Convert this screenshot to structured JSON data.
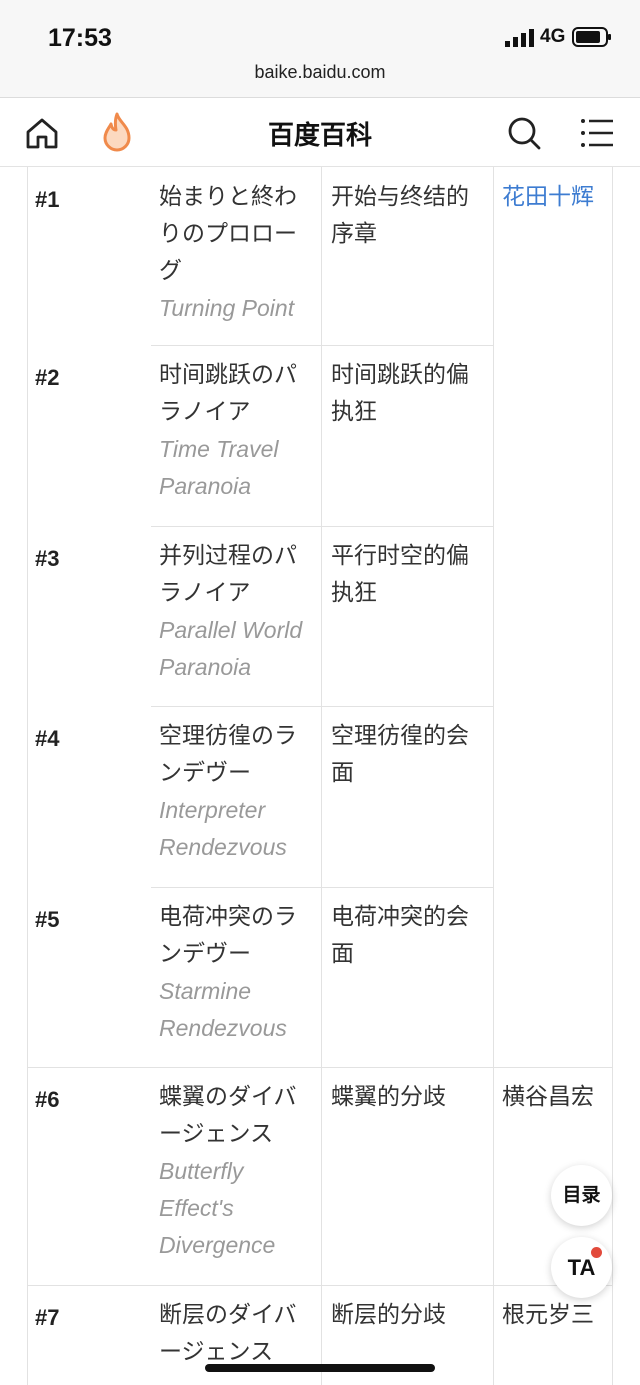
{
  "status": {
    "time": "17:53",
    "network": "4G"
  },
  "browser": {
    "url": "baike.baidu.com"
  },
  "nav": {
    "title": "百度百科",
    "icons": [
      "home-icon",
      "fire-icon",
      "search-icon",
      "menu-icon"
    ]
  },
  "table": {
    "rows": [
      {
        "num": "#1",
        "jp": "始まりと終わりのプロローグ",
        "en": "Turning Point",
        "cn": "开始与终结的序章",
        "staff": "花田十辉"
      },
      {
        "num": "#2",
        "jp": "时间跳跃のパラノイア",
        "en": "Time Travel Paranoia",
        "cn": "时间跳跃的偏执狂",
        "staff": ""
      },
      {
        "num": "#3",
        "jp": "并列过程のパラノイア",
        "en": "Parallel World Paranoia",
        "cn": "平行时空的偏执狂",
        "staff": ""
      },
      {
        "num": "#4",
        "jp": "空理彷徨のランデヴー",
        "en": "Interpreter Rendezvous",
        "cn": "空理彷徨的会面",
        "staff": ""
      },
      {
        "num": "#5",
        "jp": "电荷冲突のランデヴー",
        "en": "Starmine Rendezvous",
        "cn": "电荷冲突的会面",
        "staff": ""
      },
      {
        "num": "#6",
        "jp": "蝶翼のダイバージェンス",
        "en": "Butterfly Effect's Divergence",
        "cn": "蝶翼的分歧",
        "staff": "横谷昌宏"
      },
      {
        "num": "#7",
        "jp": "断层のダイバージェンス",
        "en": "",
        "cn": "断层的分歧",
        "staff": "根元岁三"
      }
    ]
  },
  "fab": {
    "toc": "目录",
    "ta": "TA"
  },
  "colors": {
    "link": "#3d7cd1",
    "accent_fire": "#f08a4b",
    "notification_dot": "#e24a3b"
  }
}
